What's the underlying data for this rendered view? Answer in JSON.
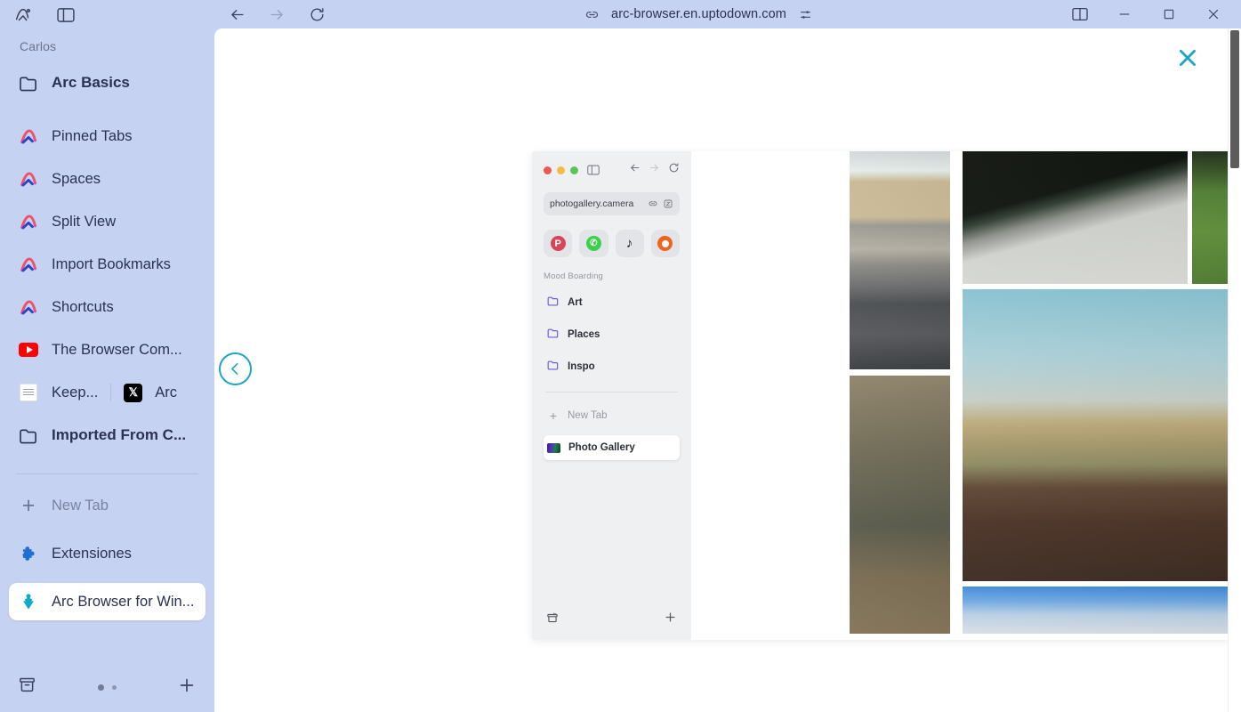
{
  "window": {
    "title_icons": [
      "arc-logo-icon",
      "sidebar-toggle-icon"
    ],
    "url": "arc-browser.en.uptodown.com",
    "nav": {
      "back": "←",
      "forward": "→",
      "reload": "↻"
    },
    "controls": {
      "split": "split-view-icon",
      "minimize": "−",
      "maximize": "□",
      "close": "✕"
    }
  },
  "sidebar": {
    "profile": "Carlos",
    "folder": "Arc Basics",
    "items": [
      {
        "label": "Pinned Tabs",
        "icon": "arc-logo-icon"
      },
      {
        "label": "Spaces",
        "icon": "arc-logo-icon"
      },
      {
        "label": "Split View",
        "icon": "arc-logo-icon"
      },
      {
        "label": "Import Bookmarks",
        "icon": "arc-logo-icon"
      },
      {
        "label": "Shortcuts",
        "icon": "arc-logo-icon"
      },
      {
        "label": "The Browser Com...",
        "icon": "youtube-icon"
      }
    ],
    "split_row": {
      "left_label": "Keep...",
      "right_label": "Arc",
      "left_icon": "keep-favicon-icon",
      "right_icon": "x-twitter-icon"
    },
    "folder2": "Imported From C...",
    "new_tab": "New Tab",
    "extensions": "Extensiones",
    "active_tab": "Arc Browser for Win...",
    "bottom": {
      "archive": "archive-icon",
      "add": "+"
    }
  },
  "overlay": {
    "close_label": "✕",
    "prev_label": "‹"
  },
  "screenshot": {
    "url": "photogallery.camera",
    "shortcuts": [
      {
        "name": "pinterest",
        "glyph": "P",
        "color": "#d6455a"
      },
      {
        "name": "whatsapp",
        "glyph": "✆",
        "color": "#3bd14c"
      },
      {
        "name": "tiktok",
        "glyph": "♪",
        "color": "#141414"
      },
      {
        "name": "reddit",
        "glyph": "●",
        "color": "#f0641e"
      }
    ],
    "section_title": "Mood Boarding",
    "folders": [
      {
        "label": "Art"
      },
      {
        "label": "Places"
      },
      {
        "label": "Inspo"
      }
    ],
    "new_tab": "New Tab",
    "open_tab": "Photo Gallery",
    "window_buttons": [
      "red",
      "yellow",
      "green"
    ],
    "photos": [
      {
        "name": "aerial-beach-road",
        "style": "p-beach"
      },
      {
        "name": "hedge-gravel-path",
        "style": "p-hedge"
      },
      {
        "name": "grass-colored-steps",
        "style": "p-grass"
      },
      {
        "name": "dark-interior",
        "style": "p-dark"
      },
      {
        "name": "hanging-lamps-cafe",
        "style": "p-lamps"
      },
      {
        "name": "desert-rooftop-loungers",
        "style": "p-desert"
      },
      {
        "name": "paris-building-street",
        "style": "p-paris"
      },
      {
        "name": "blue-sky-clouds",
        "style": "p-sky"
      }
    ]
  },
  "colors": {
    "sidebar_bg": "#c5d2f2",
    "accent_teal": "#1ba7c4",
    "text": "#2b3154",
    "muted": "#7b83a0"
  }
}
